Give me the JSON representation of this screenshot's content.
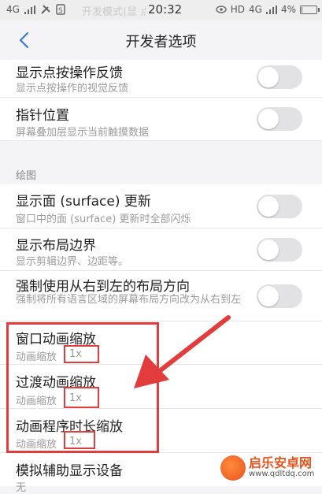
{
  "statusbar": {
    "net_left": "4G",
    "notice": "开发模式(显   点击关",
    "time": "20:32",
    "hd": "HD",
    "net_right": "4G",
    "battery": "4%",
    "battery_level": 0.04
  },
  "header": {
    "title": "开发者选项"
  },
  "rows": [
    {
      "title": "显示点按操作反馈",
      "subtitle": "显示点按操作的视觉反馈",
      "on": false
    },
    {
      "title": "指针位置",
      "subtitle": "屏幕叠加层显示当前触摸数据",
      "on": false
    },
    {
      "title": "显示面 (surface) 更新",
      "subtitle": "窗口中的面 (surface) 更新时全部闪烁",
      "on": false
    },
    {
      "title": "显示布局边界",
      "subtitle": "显示剪辑边界、边距等。",
      "on": false
    },
    {
      "title": "强制使用从右到左的布局方向",
      "subtitle": "强制将所有语言区域的屏幕布局方向改为从右到左",
      "on": false
    }
  ],
  "section": {
    "drawing": "绘图"
  },
  "scales": [
    {
      "title": "窗口动画缩放",
      "subtitle": "动画缩放",
      "value": "1x"
    },
    {
      "title": "过渡动画缩放",
      "subtitle": "动画缩放",
      "value": "1x"
    },
    {
      "title": "动画程序时长缩放",
      "subtitle": "动画缩放",
      "value": "1x"
    }
  ],
  "last_row": {
    "title": "模拟辅助显示设备",
    "subtitle": "无"
  },
  "watermark": {
    "name": "启乐安卓网",
    "url": "www.qdltdq.com"
  },
  "colors": {
    "annotation": "#e23c3c",
    "toggle_off": "#e2e2e4"
  }
}
